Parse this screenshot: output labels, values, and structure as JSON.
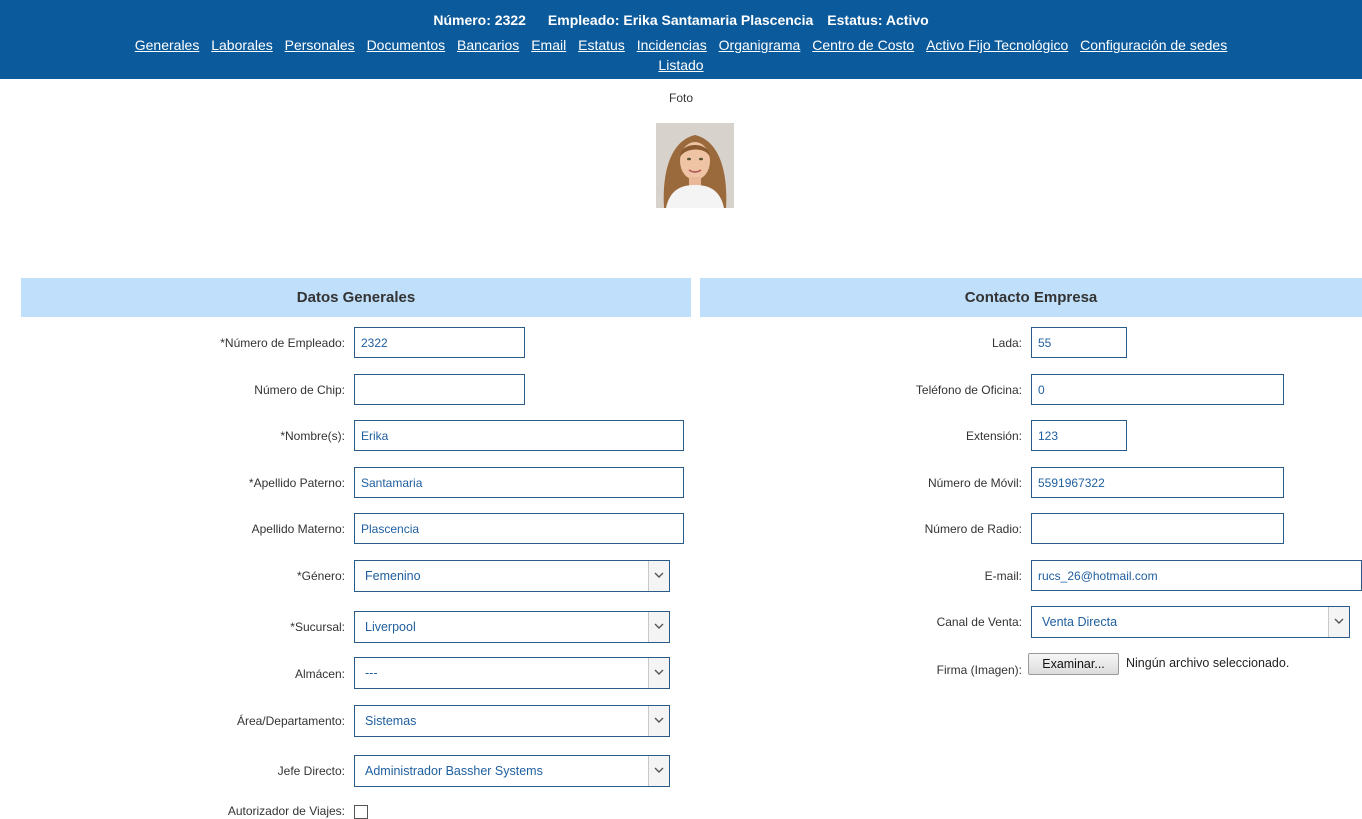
{
  "header": {
    "numero_label": "Número: 2322",
    "empleado_label": "Empleado: Erika Santamaria Plascencia",
    "estatus_label": "Estatus: Activo"
  },
  "nav": {
    "row1": [
      "Generales",
      "Laborales",
      "Personales",
      "Documentos",
      "Bancarios",
      "Email",
      "Estatus",
      "Incidencias",
      "Organigrama",
      "Centro de Costo",
      "Activo Fijo Tecnológico",
      "Configuración de sedes"
    ],
    "row2": [
      "Listado"
    ]
  },
  "photo": {
    "label": "Foto"
  },
  "datos_generales": {
    "title": "Datos Generales",
    "numero_empleado": {
      "label": "*Número de Empleado:",
      "value": "2322"
    },
    "numero_chip": {
      "label": "Número de Chip:",
      "value": ""
    },
    "nombre": {
      "label": "*Nombre(s):",
      "value": "Erika"
    },
    "apellido_paterno": {
      "label": "*Apellido Paterno:",
      "value": "Santamaria"
    },
    "apellido_materno": {
      "label": "Apellido Materno:",
      "value": "Plascencia"
    },
    "genero": {
      "label": "*Género:",
      "value": "Femenino"
    },
    "sucursal": {
      "label": "*Sucursal:",
      "value": "Liverpool"
    },
    "almacen": {
      "label": "Almácen:",
      "value": "---"
    },
    "area": {
      "label": "Área/Departamento:",
      "value": "Sistemas"
    },
    "jefe": {
      "label": "Jefe Directo:",
      "value": "Administrador Bassher Systems"
    },
    "autorizador": {
      "label": "Autorizador de Viajes:"
    }
  },
  "contacto_empresa": {
    "title": "Contacto Empresa",
    "lada": {
      "label": "Lada:",
      "value": "55"
    },
    "telefono": {
      "label": "Teléfono de Oficina:",
      "value": "0"
    },
    "extension": {
      "label": "Extensión:",
      "value": "123"
    },
    "movil": {
      "label": "Número de Móvil:",
      "value": "5591967322"
    },
    "radio": {
      "label": "Número de Radio:",
      "value": ""
    },
    "email": {
      "label": "E-mail:",
      "value": "rucs_26@hotmail.com"
    },
    "canal": {
      "label": "Canal de Venta:",
      "value": "Venta Directa"
    },
    "firma": {
      "label": "Firma (Imagen):",
      "button": "Examinar...",
      "status": "Ningún archivo seleccionado."
    }
  },
  "colors": {
    "topbar": "#0b5a9b",
    "section_header": "#bfdffa",
    "field_text": "#1f5fa0"
  }
}
